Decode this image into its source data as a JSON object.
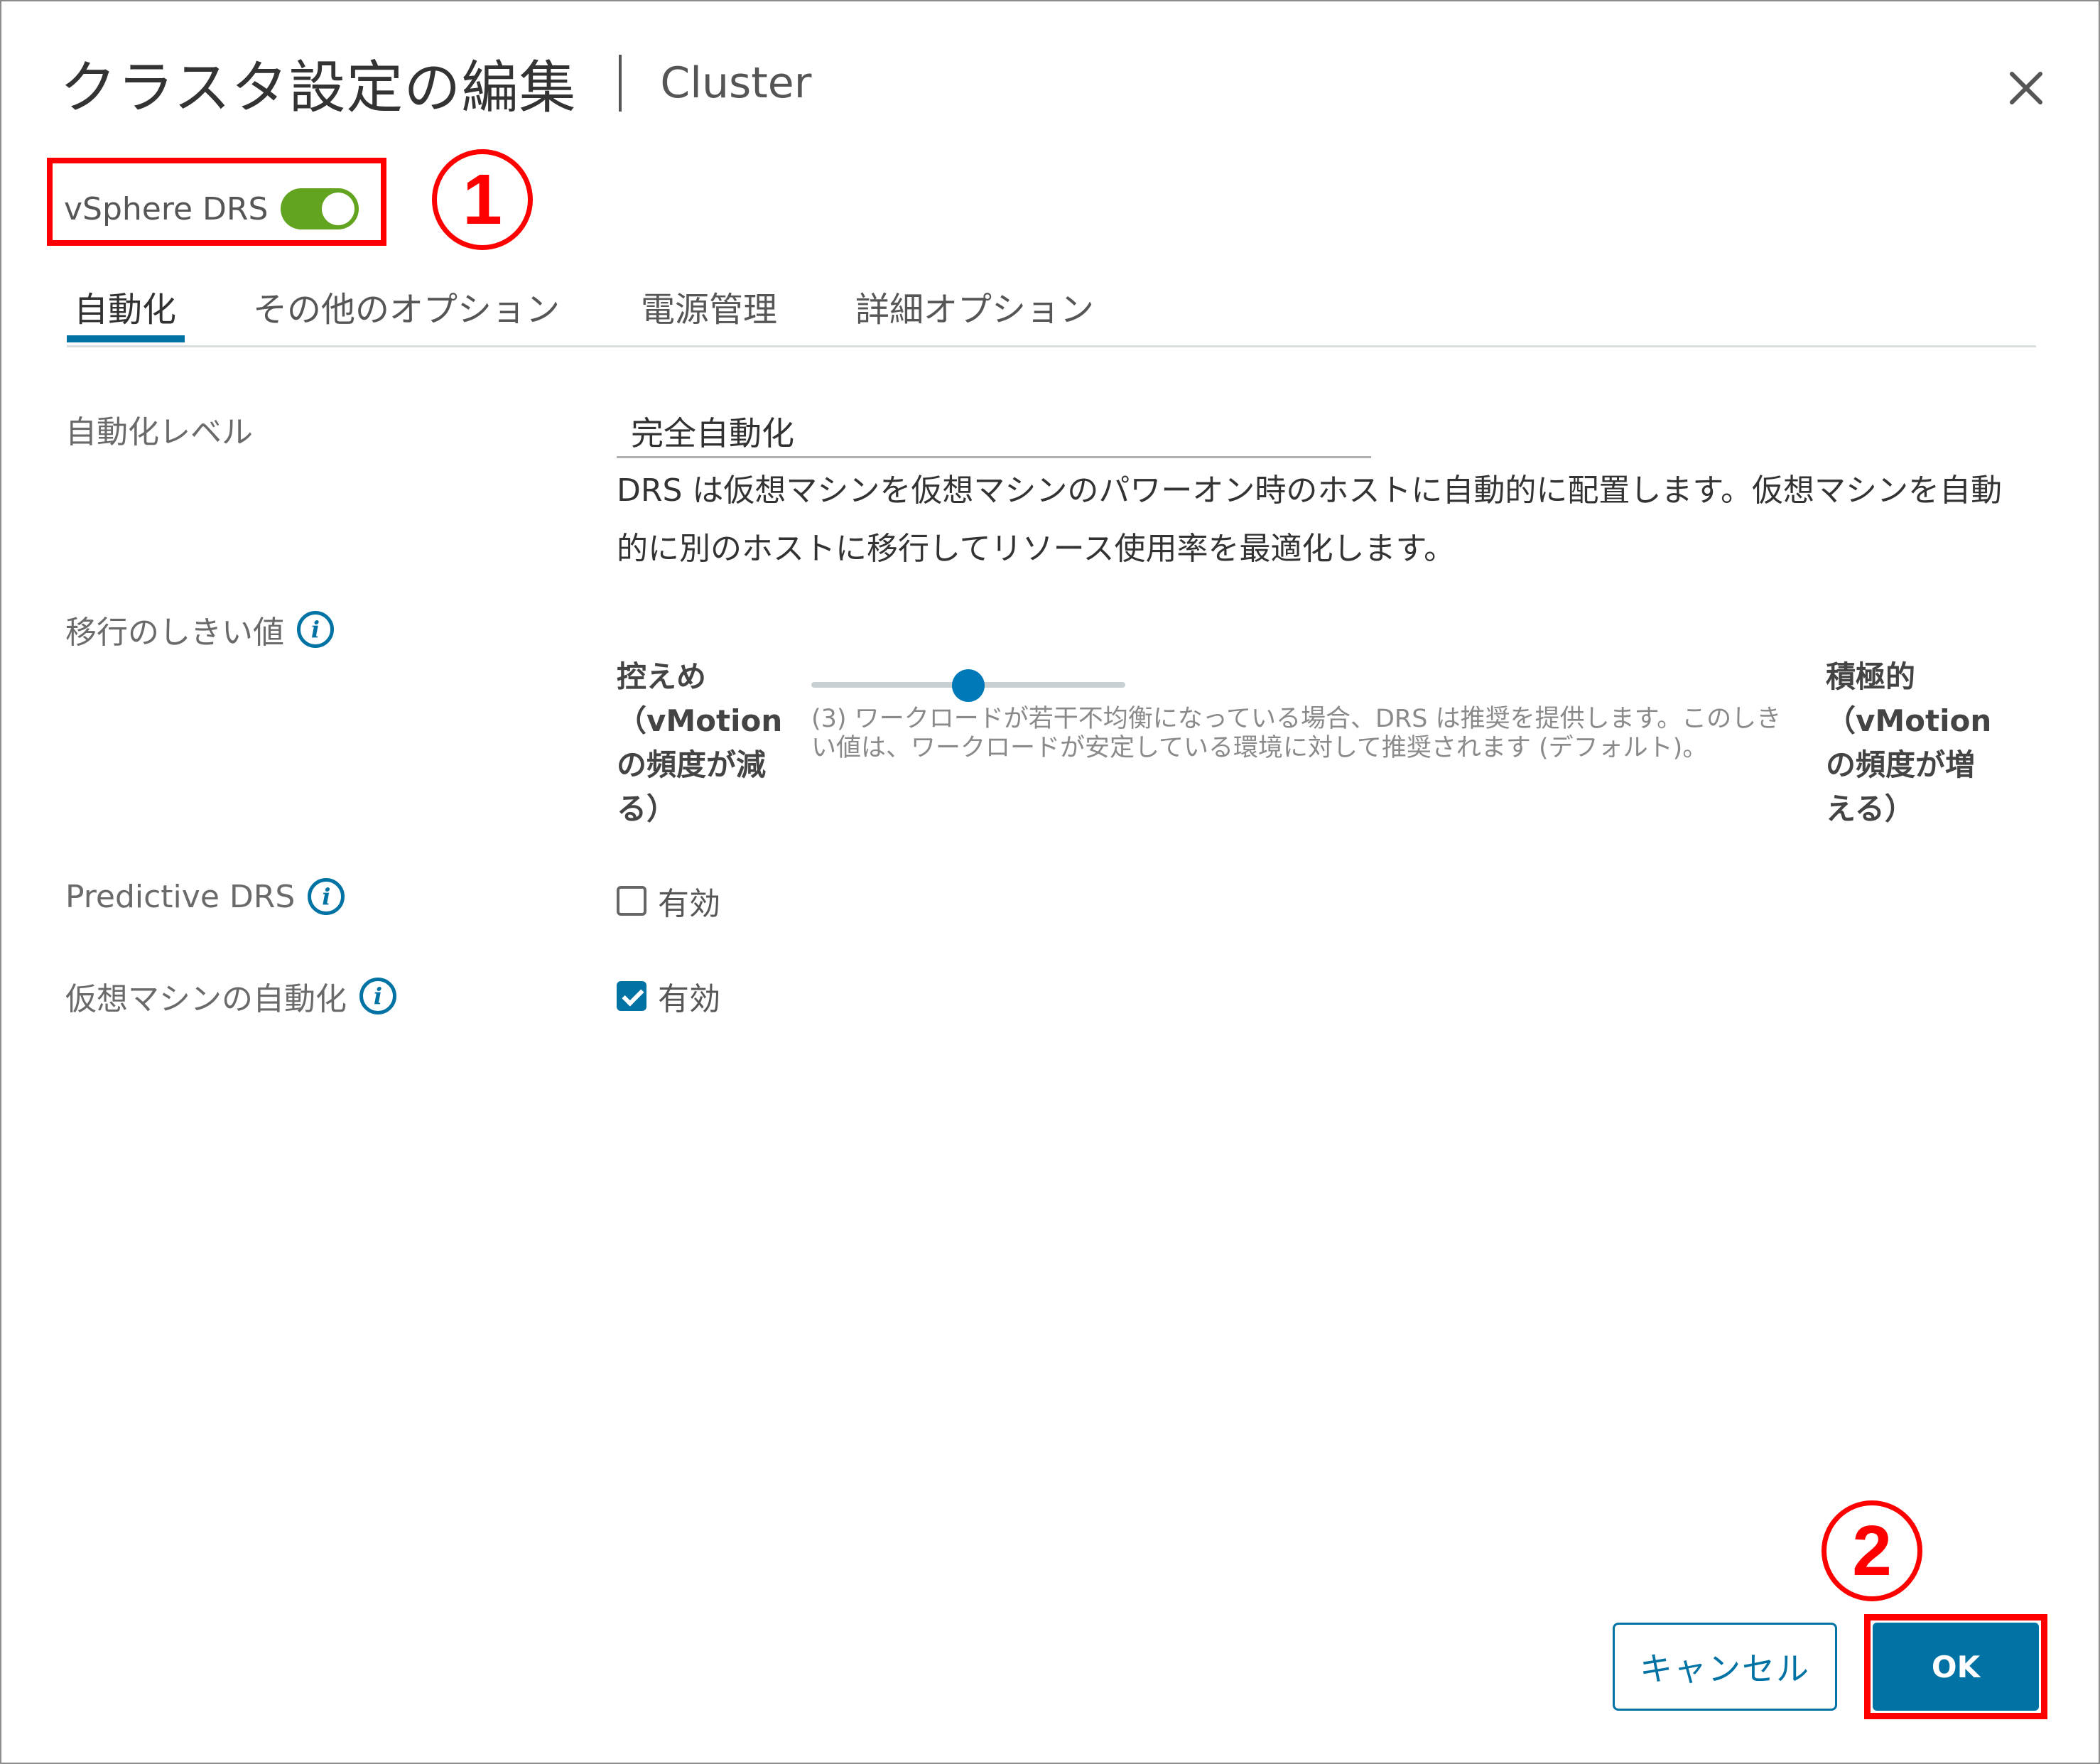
{
  "dialog": {
    "title": "クラスタ設定の編集",
    "subtitle": "Cluster",
    "close_glyph": "✕"
  },
  "drs": {
    "label": "vSphere DRS",
    "enabled": true
  },
  "annotations": {
    "marker1": "1",
    "marker2": "2",
    "color": "#ff0000"
  },
  "tabs": [
    {
      "label": "自動化",
      "active": true
    },
    {
      "label": "その他のオプション",
      "active": false
    },
    {
      "label": "電源管理",
      "active": false
    },
    {
      "label": "詳細オプション",
      "active": false
    }
  ],
  "automation": {
    "level_label": "自動化レベル",
    "level_value": "完全自動化",
    "level_description": "DRS は仮想マシンを仮想マシンのパワーオン時のホストに自動的に配置します。仮想マシンを自動的に別のホストに移行してリソース使用率を最適化します。"
  },
  "threshold": {
    "label": "移行のしきい値",
    "info_icon": "i",
    "left_label": "控えめ（vMotionの頻度が減る）",
    "right_label": "積極的（vMotionの頻度が増える）",
    "level": 3,
    "levels_total": 5,
    "description": "(3) ワークロードが若干不均衡になっている場合、DRS は推奨を提供します。このしきい値は、ワークロードが安定している環境に対して推奨されます (デフォルト)。"
  },
  "predictive_drs": {
    "label": "Predictive DRS",
    "info_icon": "i",
    "checkbox_label": "有効",
    "checked": false
  },
  "vm_automation": {
    "label": "仮想マシンの自動化",
    "info_icon": "i",
    "checkbox_label": "有効",
    "checked": true
  },
  "footer": {
    "cancel_label": "キャンセル",
    "ok_label": "OK"
  },
  "colors": {
    "accent": "#0072a3",
    "toggle_on": "#62a420",
    "highlight": "#ff0000"
  }
}
